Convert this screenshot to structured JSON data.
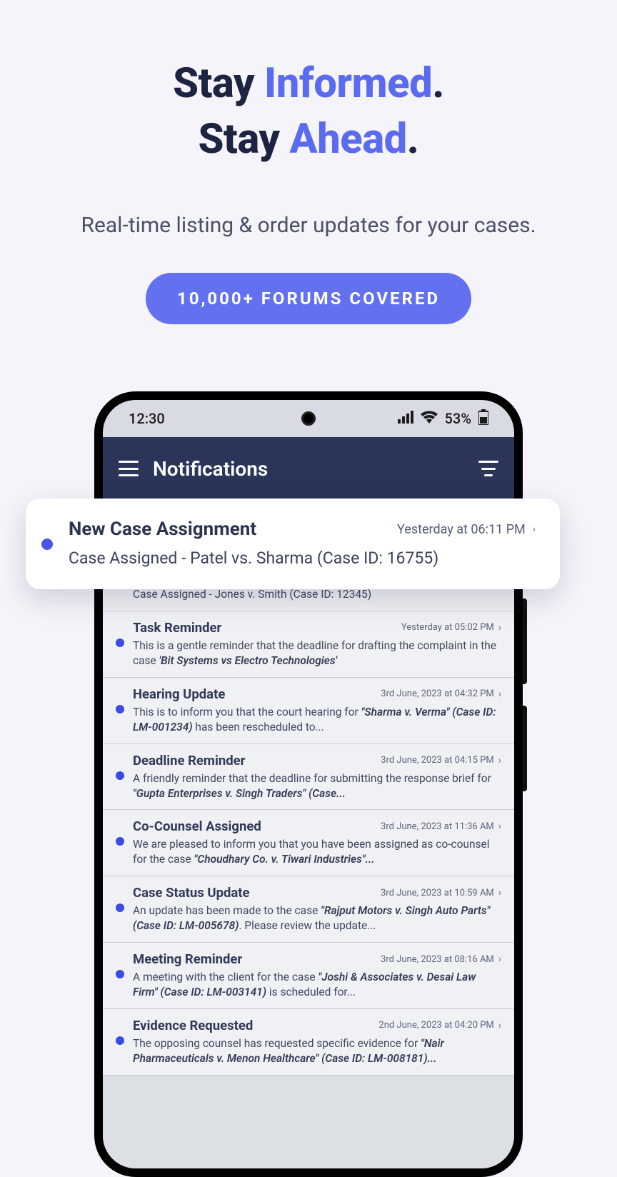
{
  "hero": {
    "line1_pre": "Stay ",
    "line1_accent": "Informed",
    "line1_post": ".",
    "line2_pre": "Stay ",
    "line2_accent": "Ahead",
    "line2_post": ".",
    "subtitle": "Real-time listing & order updates for your cases.",
    "badge": "10,000+ FORUMS COVERED"
  },
  "phone": {
    "status": {
      "time": "12:30",
      "battery": "53%"
    },
    "header": {
      "title": "Notifications"
    }
  },
  "highlight": {
    "title": "New Case Assignment",
    "time": "Yesterday at 06:11 PM",
    "body": "Case Assigned - Patel vs. Sharma (Case ID: 16755)"
  },
  "hidden_first_body": "Case Assigned - Jones v. Smith (Case ID: 12345)",
  "notifs": [
    {
      "title": "Task Reminder",
      "time": "Yesterday at 05:02 PM",
      "body_pre": "This is a gentle reminder that the deadline for drafting the complaint in the case ",
      "body_em": "'Bit Systems vs Electro Technologies'",
      "body_post": ""
    },
    {
      "title": "Hearing Update",
      "time": "3rd June, 2023 at 04:32 PM",
      "body_pre": "This is to inform you that the court hearing for ",
      "body_em": "\"Sharma v. Verma\" (Case ID: LM-001234)",
      "body_post": " has been rescheduled to..."
    },
    {
      "title": "Deadline Reminder",
      "time": "3rd June, 2023 at 04:15 PM",
      "body_pre": "A friendly reminder that the deadline for submitting the response brief for ",
      "body_em": "\"Gupta Enterprises v. Singh Traders\" (Case...",
      "body_post": ""
    },
    {
      "title": "Co-Counsel Assigned",
      "time": "3rd June, 2023 at 11:36 AM",
      "body_pre": "We are pleased to inform you that you have been assigned as co-counsel for the case ",
      "body_em": "\"Choudhary Co. v. Tiwari Industries\"...",
      "body_post": ""
    },
    {
      "title": "Case Status Update",
      "time": "3rd June, 2023 at 10:59 AM",
      "body_pre": "An update has been made to the case ",
      "body_em": "\"Rajput Motors v. Singh Auto Parts\" (Case ID: LM-005678)",
      "body_post": ". Please review the update..."
    },
    {
      "title": "Meeting Reminder",
      "time": "3rd June, 2023 at 08:16 AM",
      "body_pre": "A meeting with the client for the case ",
      "body_em": "\"Joshi & Associates v. Desai Law Firm\" (Case ID: LM-003141)",
      "body_post": " is scheduled for..."
    },
    {
      "title": "Evidence Requested",
      "time": "2nd June, 2023 at 04:20 PM",
      "body_pre": "The opposing counsel has requested specific evidence for ",
      "body_em": "\"Nair Pharmaceuticals v. Menon Healthcare\" (Case ID: LM-008181)...",
      "body_post": ""
    }
  ]
}
